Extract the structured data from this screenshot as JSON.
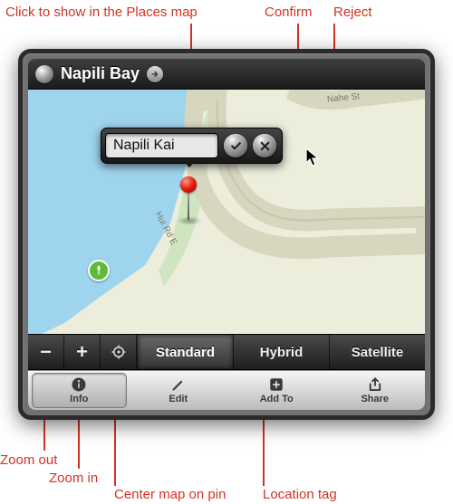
{
  "annotations": {
    "show_in_places": "Click to show in the Places map",
    "confirm": "Confirm",
    "reject": "Reject",
    "zoom_out": "Zoom out",
    "zoom_in": "Zoom in",
    "center": "Center map on pin",
    "location_tag": "Location tag"
  },
  "titlebar": {
    "title": "Napili Bay"
  },
  "popover": {
    "value": "Napili Kai"
  },
  "map": {
    "road_labels": [
      "Hui Rd E",
      "Nahe St"
    ],
    "view_modes": [
      "Standard",
      "Hybrid",
      "Satellite"
    ],
    "selected_mode": 0,
    "zoom_out_glyph": "−",
    "zoom_in_glyph": "+"
  },
  "toolbar": {
    "items": [
      {
        "label": "Info"
      },
      {
        "label": "Edit"
      },
      {
        "label": "Add To"
      },
      {
        "label": "Share"
      }
    ],
    "selected": 0
  }
}
